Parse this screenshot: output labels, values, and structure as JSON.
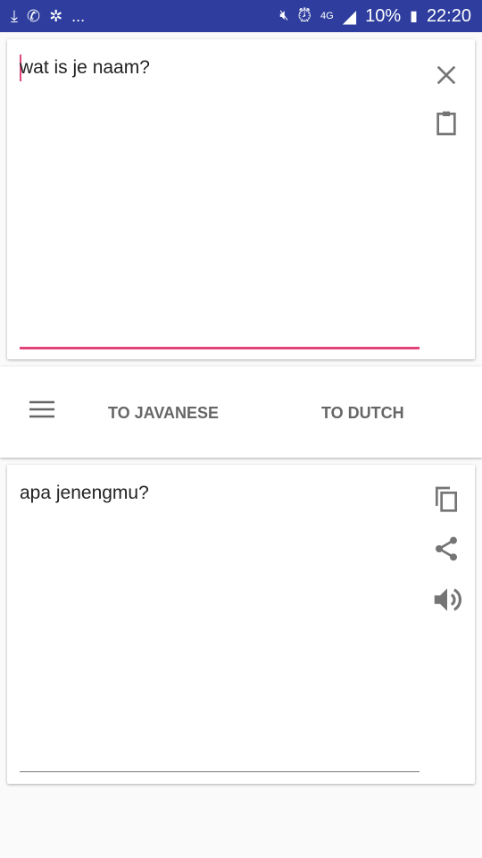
{
  "status_bar": {
    "notifications": "...",
    "battery": "10%",
    "time": "22:20"
  },
  "input": {
    "value": "wat is je naam?"
  },
  "actions": {
    "to_javanese": "TO JAVANESE",
    "to_dutch": "TO DUTCH"
  },
  "output": {
    "value": "apa jenengmu?"
  },
  "colors": {
    "status_bar": "#2f3e9e",
    "accent": "#e0457b"
  }
}
